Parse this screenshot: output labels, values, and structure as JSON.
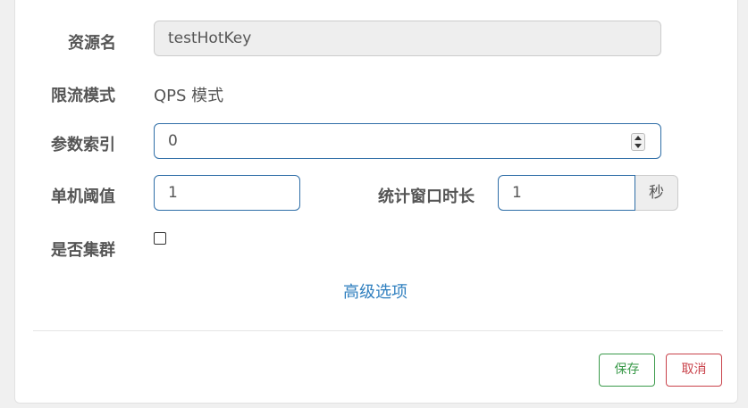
{
  "form": {
    "resource_name": {
      "label": "资源名",
      "value": "testHotKey"
    },
    "limit_mode": {
      "label": "限流模式",
      "value": "QPS 模式"
    },
    "param_index": {
      "label": "参数索引",
      "value": "0"
    },
    "threshold": {
      "label": "单机阈值",
      "value": "1"
    },
    "window": {
      "label": "统计窗口时长",
      "value": "1",
      "unit": "秒"
    },
    "cluster": {
      "label": "是否集群",
      "checked": false
    },
    "advanced_link": "高级选项"
  },
  "footer": {
    "save_label": "保存",
    "cancel_label": "取消"
  },
  "colors": {
    "input_border": "#2f6ea7",
    "link": "#2f7fbf",
    "save": "#3a9a4a",
    "cancel": "#c9424a"
  }
}
